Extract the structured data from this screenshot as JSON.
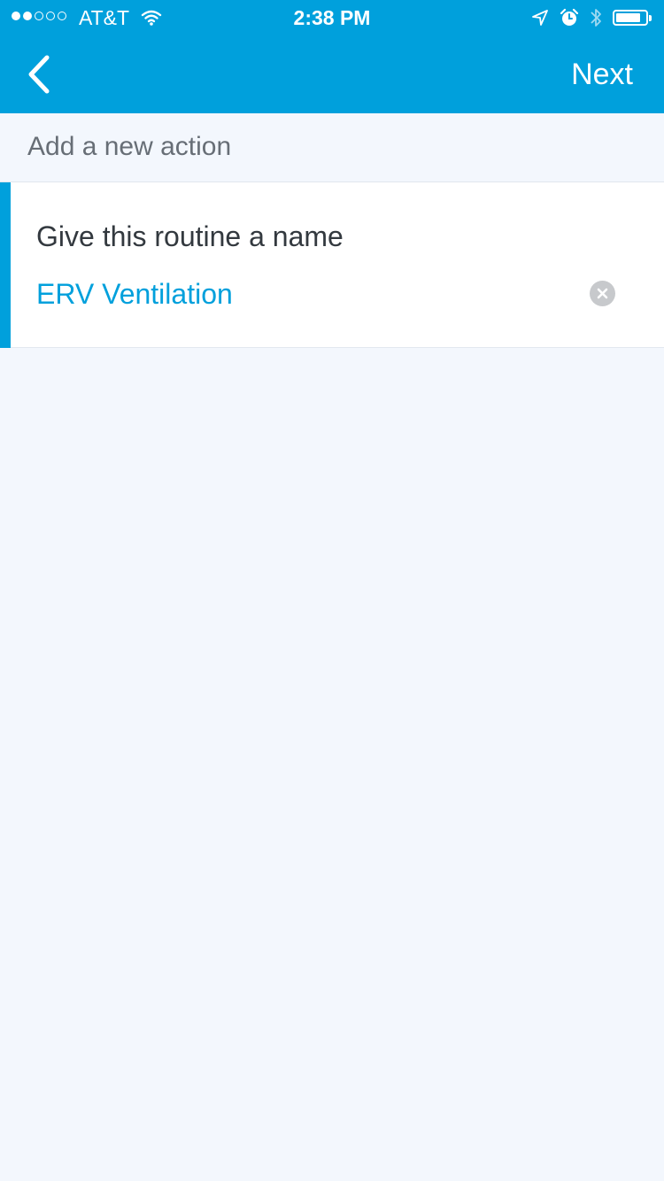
{
  "status_bar": {
    "carrier": "AT&T",
    "time": "2:38 PM",
    "signal_bars_filled": 2,
    "signal_bars_total": 5,
    "battery_level": 0.85,
    "icons": [
      "wifi-icon",
      "location-arrow-icon",
      "alarm-icon",
      "bluetooth-icon",
      "battery-icon"
    ]
  },
  "nav": {
    "back_icon": "chevron-left-icon",
    "next_label": "Next"
  },
  "section": {
    "title": "Add a new action"
  },
  "routine_name": {
    "label": "Give this routine a name",
    "value": "ERV Ventilation",
    "clear_icon": "clear-x-icon"
  },
  "colors": {
    "accent": "#00a0dc",
    "background": "#f3f7fd",
    "card": "#ffffff"
  }
}
